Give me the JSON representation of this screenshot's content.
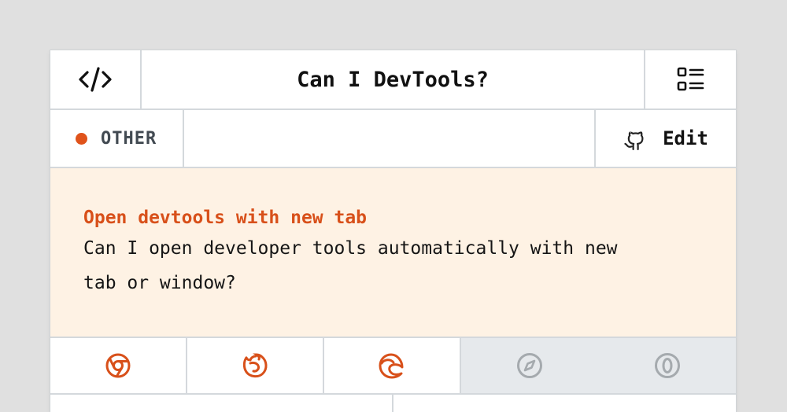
{
  "header": {
    "title": "Can I DevTools?",
    "left_icon": "code-icon",
    "right_icon": "list-menu-icon"
  },
  "meta": {
    "category": "OTHER",
    "category_color": "#e0531b",
    "edit_label": "Edit",
    "edit_icon": "github-icon"
  },
  "feature": {
    "title": "Open devtools with new tab",
    "description_line1": "Can I open developer tools automatically with new",
    "description_line2": "tab or window?"
  },
  "browsers": [
    {
      "name": "chrome-icon",
      "supported": true,
      "color": "#d8501a"
    },
    {
      "name": "firefox-icon",
      "supported": true,
      "color": "#d8501a"
    },
    {
      "name": "edge-icon",
      "supported": true,
      "color": "#d8501a"
    },
    {
      "name": "safari-icon",
      "supported": false,
      "color": "#a5aaae"
    },
    {
      "name": "opera-icon",
      "supported": false,
      "color": "#a5aaae"
    }
  ],
  "colors": {
    "accent": "#d8501a",
    "feature_bg": "#fef2e4",
    "unsupported_bg": "#e6e9ec"
  }
}
